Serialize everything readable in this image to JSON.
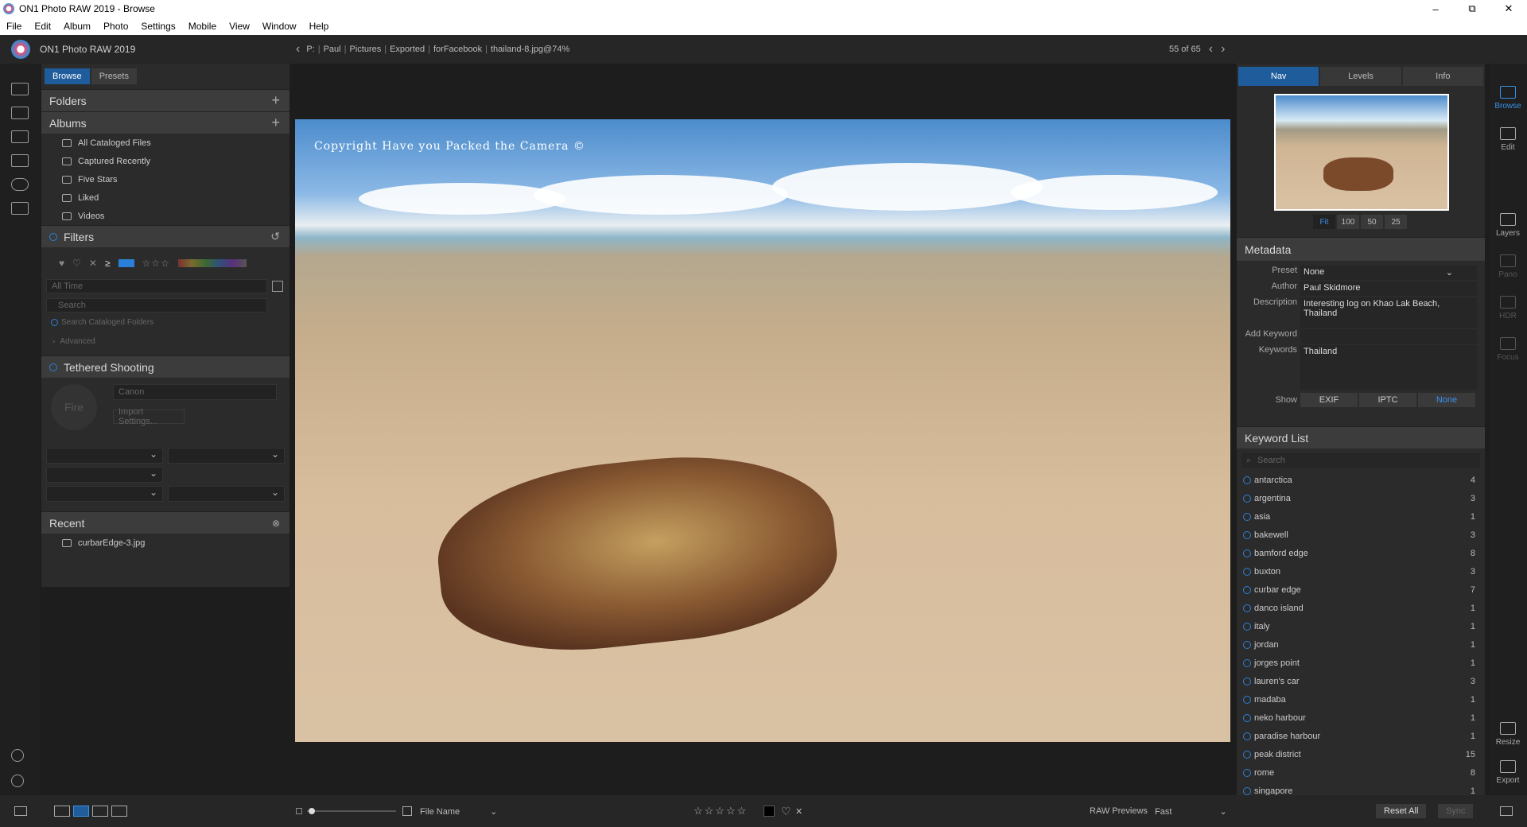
{
  "window": {
    "title": "ON1 Photo RAW 2019 - Browse",
    "controls": [
      "–",
      "⧉",
      "✕"
    ]
  },
  "menu": [
    "File",
    "Edit",
    "Album",
    "Photo",
    "Settings",
    "Mobile",
    "View",
    "Window",
    "Help"
  ],
  "appbar": {
    "app_name": "ON1 Photo RAW 2019",
    "breadcrumb": [
      "P:",
      "Paul",
      "Pictures",
      "Exported",
      "forFacebook",
      "thailand-8.jpg@74%"
    ],
    "position": "55 of 65"
  },
  "left_panel": {
    "tabs": [
      "Browse",
      "Presets"
    ],
    "folders_title": "Folders",
    "albums_title": "Albums",
    "albums": [
      "All Cataloged Files",
      "Captured Recently",
      "Five Stars",
      "Liked",
      "Videos"
    ],
    "filters_title": "Filters",
    "time_field": "All Time",
    "search_placeholder": "Search",
    "search_cataloged": "Search Cataloged Folders",
    "advanced": "Advanced",
    "tethered_title": "Tethered Shooting",
    "fire_label": "Fire",
    "camera_field": "Canon",
    "import_settings": "Import Settings...",
    "recent_title": "Recent",
    "recent_items": [
      "curbarEdge-3.jpg"
    ]
  },
  "image": {
    "watermark": "Copyright Have you Packed the Camera ©"
  },
  "right_panel": {
    "tabs": [
      "Nav",
      "Levels",
      "Info"
    ],
    "zoom_levels": [
      "Fit",
      "100",
      "50",
      "25"
    ],
    "metadata_title": "Metadata",
    "preset_label": "Preset",
    "preset_value": "None",
    "author_label": "Author",
    "author_value": "Paul Skidmore",
    "description_label": "Description",
    "description_value": "Interesting log on Khao Lak Beach, Thailand",
    "add_keyword_label": "Add Keyword",
    "keywords_label": "Keywords",
    "keywords_value": "Thailand",
    "show_label": "Show",
    "show_options": [
      "EXIF",
      "IPTC",
      "None"
    ],
    "keyword_list_title": "Keyword List",
    "keyword_search_placeholder": "Search",
    "keywords": [
      {
        "name": "antarctica",
        "count": "4"
      },
      {
        "name": "argentina",
        "count": "3"
      },
      {
        "name": "asia",
        "count": "1"
      },
      {
        "name": "bakewell",
        "count": "3"
      },
      {
        "name": "bamford edge",
        "count": "8"
      },
      {
        "name": "buxton",
        "count": "3"
      },
      {
        "name": "curbar edge",
        "count": "7"
      },
      {
        "name": "danco island",
        "count": "1"
      },
      {
        "name": "italy",
        "count": "1"
      },
      {
        "name": "jordan",
        "count": "1"
      },
      {
        "name": "jorges point",
        "count": "1"
      },
      {
        "name": "lauren's car",
        "count": "3"
      },
      {
        "name": "madaba",
        "count": "1"
      },
      {
        "name": "neko harbour",
        "count": "1"
      },
      {
        "name": "paradise harbour",
        "count": "1"
      },
      {
        "name": "peak district",
        "count": "15"
      },
      {
        "name": "rome",
        "count": "8"
      },
      {
        "name": "singapore",
        "count": "1"
      }
    ]
  },
  "module_icons": [
    "Browse",
    "Edit",
    "Layers",
    "Pano",
    "HDR",
    "Focus",
    "Resize",
    "Export"
  ],
  "bottom_bar": {
    "sort_label": "File Name",
    "raw_previews_label": "RAW Previews",
    "raw_previews_value": "Fast",
    "reset_all": "Reset All",
    "sync": "Sync"
  },
  "colors": {
    "accent": "#1f5c9c",
    "link_blue": "#3a90e8"
  }
}
